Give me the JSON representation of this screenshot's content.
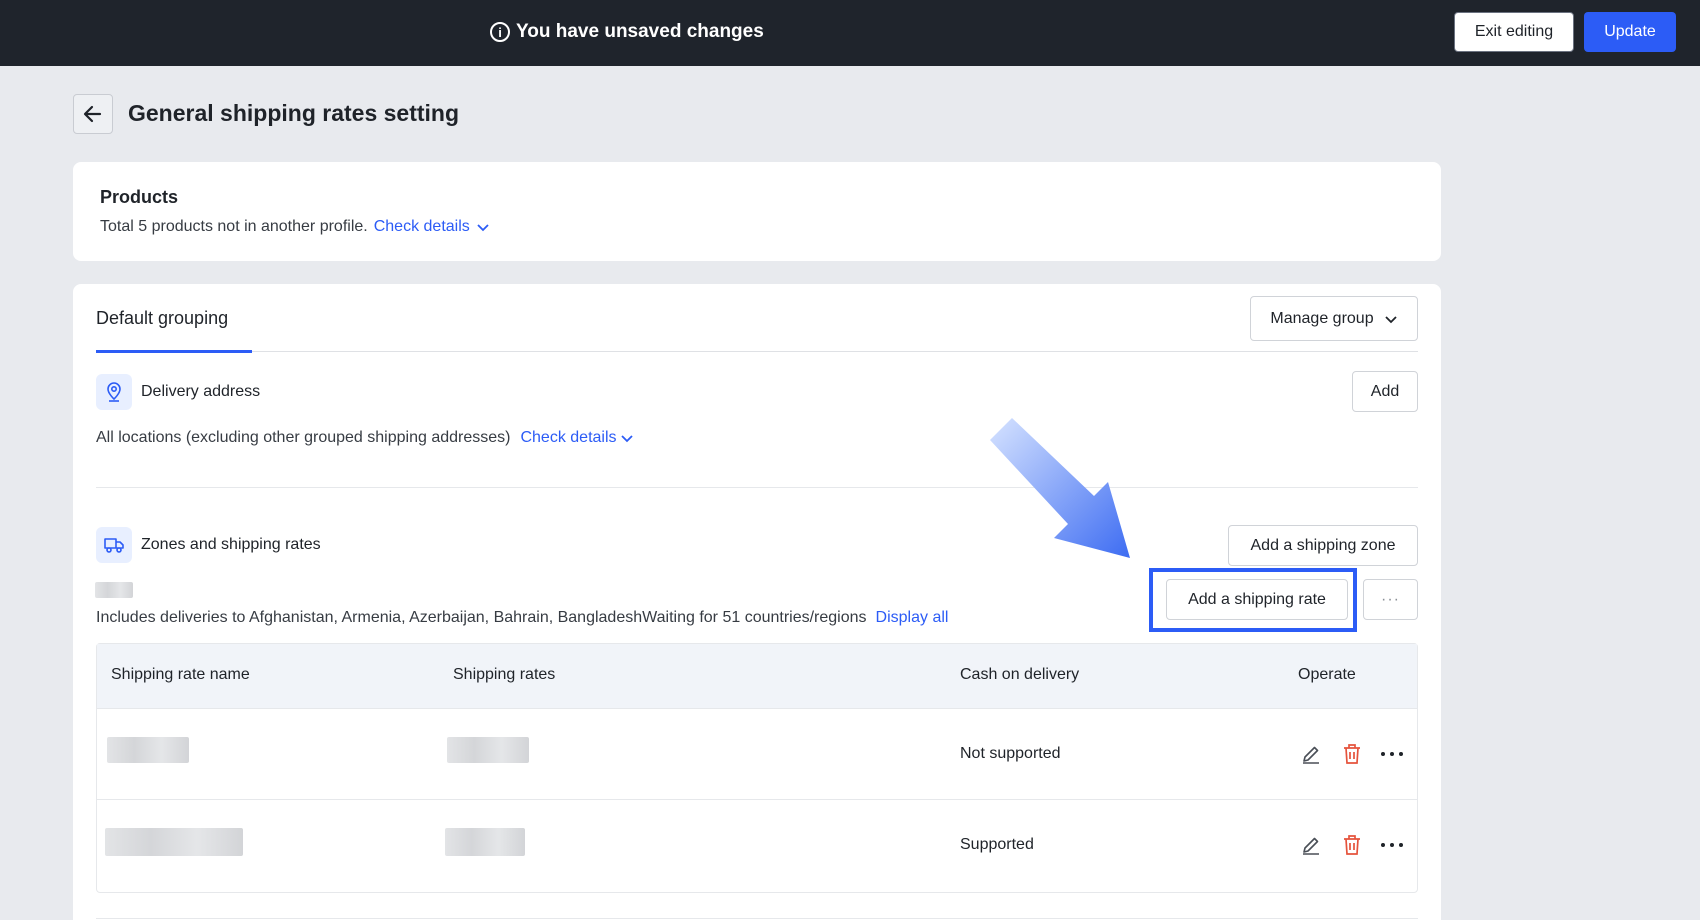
{
  "topbar": {
    "message": "You have unsaved changes",
    "info_glyph": "i",
    "exit_label": "Exit editing",
    "update_label": "Update"
  },
  "page": {
    "title": "General shipping rates setting"
  },
  "products": {
    "title": "Products",
    "description": "Total 5 products not in another profile.",
    "check_details": "Check details"
  },
  "grouping": {
    "tab_label": "Default grouping",
    "manage_label": "Manage group",
    "delivery": {
      "title": "Delivery address",
      "add_label": "Add",
      "description": "All locations (excluding other grouped shipping addresses)",
      "check_details": "Check details"
    },
    "zones": {
      "title": "Zones and shipping rates",
      "add_zone_label": "Add a shipping zone",
      "add_rate_label": "Add a shipping rate",
      "more_label": "···",
      "description": "Includes deliveries to Afghanistan, Armenia, Azerbaijan, Bahrain, BangladeshWaiting for 51 countries/regions",
      "display_all": "Display all"
    },
    "table": {
      "columns": [
        "Shipping rate name",
        "Shipping rates",
        "Cash on delivery",
        "Operate"
      ],
      "rows": [
        {
          "cod": "Not supported"
        },
        {
          "cod": "Supported"
        }
      ]
    }
  },
  "colors": {
    "accent": "#2c5cf6",
    "topbar": "#1f242c",
    "delete": "#e5533c"
  }
}
